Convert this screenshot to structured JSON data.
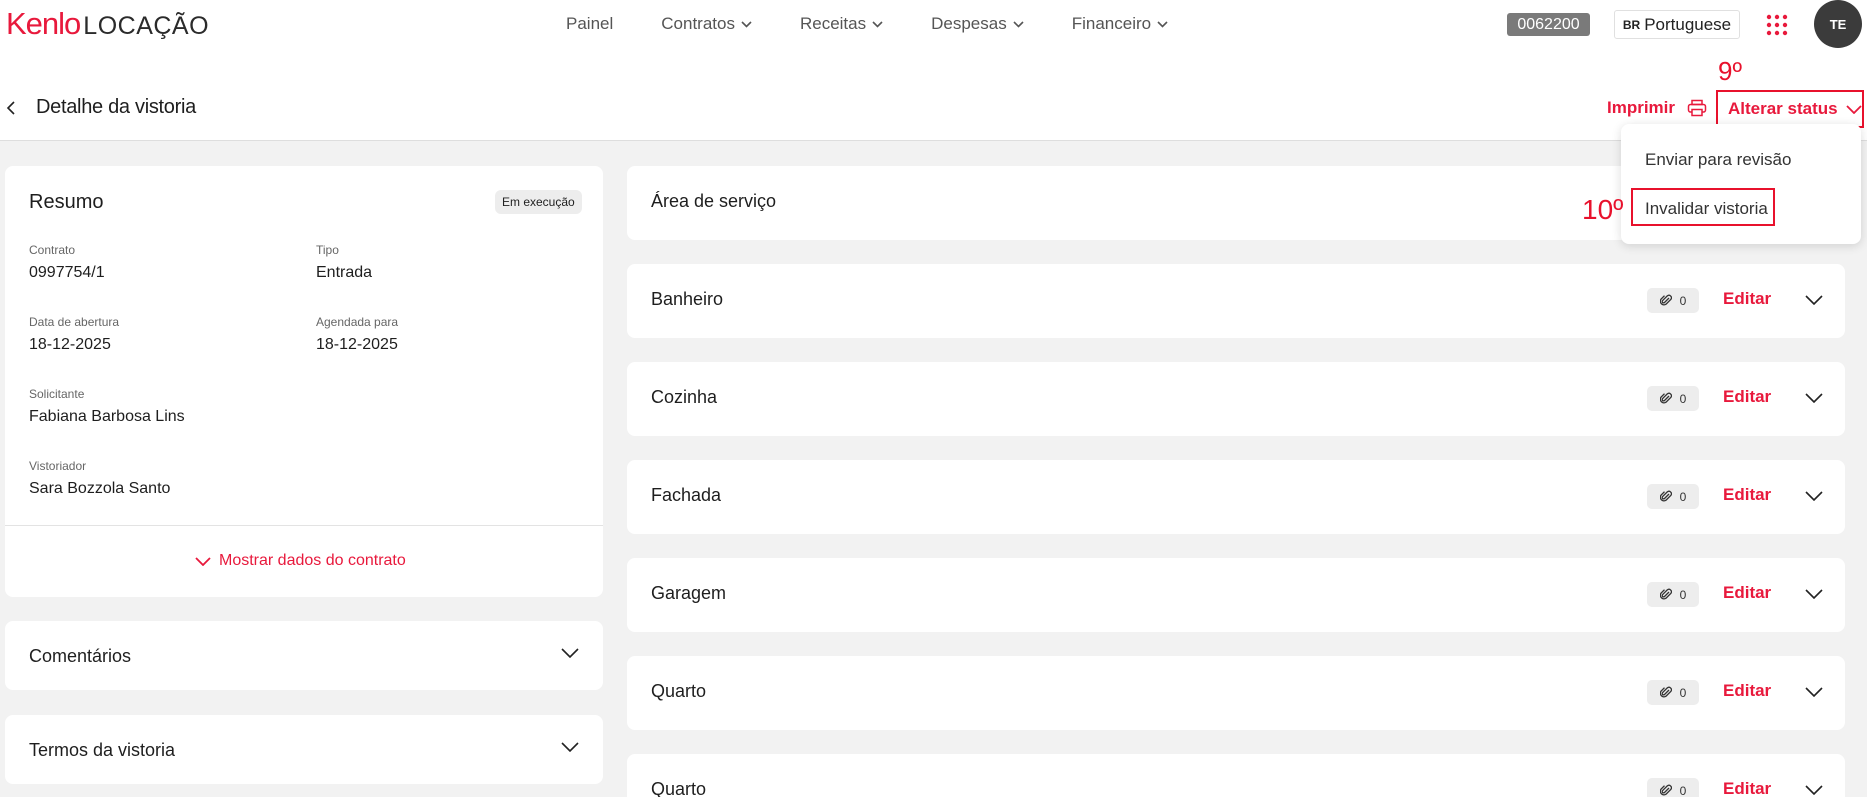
{
  "brand": {
    "logo_brand": "Kenlo",
    "logo_product": "LOCAÇÃO"
  },
  "nav": {
    "items": [
      {
        "label": "Painel",
        "has_dropdown": false
      },
      {
        "label": "Contratos",
        "has_dropdown": true
      },
      {
        "label": "Receitas",
        "has_dropdown": true
      },
      {
        "label": "Despesas",
        "has_dropdown": true
      },
      {
        "label": "Financeiro",
        "has_dropdown": true
      }
    ]
  },
  "topbar": {
    "contract_code": "0062200",
    "language_flag": "BR",
    "language": "Portuguese",
    "apps_icon": "grid-dots-icon",
    "avatar_initials": "TE"
  },
  "header": {
    "title": "Detalhe da vistoria",
    "print_label": "Imprimir",
    "status_label": "Alterar status",
    "step_status": "9º"
  },
  "status_menu": {
    "items": [
      "Enviar para revisão",
      "Invalidar vistoria"
    ],
    "step_invalidate": "10º"
  },
  "summary": {
    "title": "Resumo",
    "status_pill": "Em execução",
    "fields": {
      "contrato": {
        "label": "Contrato",
        "value": "0997754/1"
      },
      "tipo": {
        "label": "Tipo",
        "value": "Entrada"
      },
      "data_abertura": {
        "label": "Data de abertura",
        "value": "18-12-2025"
      },
      "agendada_para": {
        "label": "Agendada para",
        "value": "18-12-2025"
      },
      "solicitante": {
        "label": "Solicitante",
        "value": "Fabiana Barbosa Lins"
      },
      "vistoriador": {
        "label": "Vistoriador",
        "value": "Sara Bozzola Santo"
      }
    },
    "show_contract_label": "Mostrar dados do contrato"
  },
  "left_sections": {
    "comentarios": "Comentários",
    "termos": "Termos da vistoria"
  },
  "rooms": [
    {
      "name": "Área de serviço"
    },
    {
      "name": "Banheiro",
      "attachments": "0",
      "edit_label": "Editar"
    },
    {
      "name": "Cozinha",
      "attachments": "0",
      "edit_label": "Editar"
    },
    {
      "name": "Fachada",
      "attachments": "0",
      "edit_label": "Editar"
    },
    {
      "name": "Garagem",
      "attachments": "0",
      "edit_label": "Editar"
    },
    {
      "name": "Quarto",
      "attachments": "0",
      "edit_label": "Editar"
    },
    {
      "name": "Quarto",
      "attachments": "0",
      "edit_label": "Editar"
    }
  ],
  "colors": {
    "accent": "#e8193c",
    "annotation": "#e8112c",
    "background": "#f2f2f2",
    "chip": "#7a7a7a"
  }
}
